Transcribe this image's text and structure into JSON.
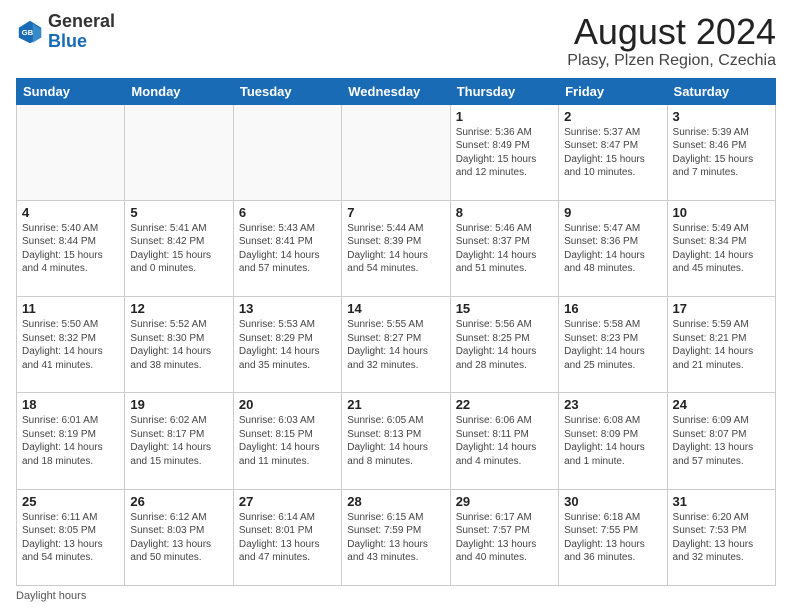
{
  "header": {
    "logo_general": "General",
    "logo_blue": "Blue",
    "month_title": "August 2024",
    "subtitle": "Plasy, Plzen Region, Czechia"
  },
  "calendar": {
    "days_of_week": [
      "Sunday",
      "Monday",
      "Tuesday",
      "Wednesday",
      "Thursday",
      "Friday",
      "Saturday"
    ],
    "weeks": [
      [
        {
          "day": "",
          "info": ""
        },
        {
          "day": "",
          "info": ""
        },
        {
          "day": "",
          "info": ""
        },
        {
          "day": "",
          "info": ""
        },
        {
          "day": "1",
          "info": "Sunrise: 5:36 AM\nSunset: 8:49 PM\nDaylight: 15 hours\nand 12 minutes."
        },
        {
          "day": "2",
          "info": "Sunrise: 5:37 AM\nSunset: 8:47 PM\nDaylight: 15 hours\nand 10 minutes."
        },
        {
          "day": "3",
          "info": "Sunrise: 5:39 AM\nSunset: 8:46 PM\nDaylight: 15 hours\nand 7 minutes."
        }
      ],
      [
        {
          "day": "4",
          "info": "Sunrise: 5:40 AM\nSunset: 8:44 PM\nDaylight: 15 hours\nand 4 minutes."
        },
        {
          "day": "5",
          "info": "Sunrise: 5:41 AM\nSunset: 8:42 PM\nDaylight: 15 hours\nand 0 minutes."
        },
        {
          "day": "6",
          "info": "Sunrise: 5:43 AM\nSunset: 8:41 PM\nDaylight: 14 hours\nand 57 minutes."
        },
        {
          "day": "7",
          "info": "Sunrise: 5:44 AM\nSunset: 8:39 PM\nDaylight: 14 hours\nand 54 minutes."
        },
        {
          "day": "8",
          "info": "Sunrise: 5:46 AM\nSunset: 8:37 PM\nDaylight: 14 hours\nand 51 minutes."
        },
        {
          "day": "9",
          "info": "Sunrise: 5:47 AM\nSunset: 8:36 PM\nDaylight: 14 hours\nand 48 minutes."
        },
        {
          "day": "10",
          "info": "Sunrise: 5:49 AM\nSunset: 8:34 PM\nDaylight: 14 hours\nand 45 minutes."
        }
      ],
      [
        {
          "day": "11",
          "info": "Sunrise: 5:50 AM\nSunset: 8:32 PM\nDaylight: 14 hours\nand 41 minutes."
        },
        {
          "day": "12",
          "info": "Sunrise: 5:52 AM\nSunset: 8:30 PM\nDaylight: 14 hours\nand 38 minutes."
        },
        {
          "day": "13",
          "info": "Sunrise: 5:53 AM\nSunset: 8:29 PM\nDaylight: 14 hours\nand 35 minutes."
        },
        {
          "day": "14",
          "info": "Sunrise: 5:55 AM\nSunset: 8:27 PM\nDaylight: 14 hours\nand 32 minutes."
        },
        {
          "day": "15",
          "info": "Sunrise: 5:56 AM\nSunset: 8:25 PM\nDaylight: 14 hours\nand 28 minutes."
        },
        {
          "day": "16",
          "info": "Sunrise: 5:58 AM\nSunset: 8:23 PM\nDaylight: 14 hours\nand 25 minutes."
        },
        {
          "day": "17",
          "info": "Sunrise: 5:59 AM\nSunset: 8:21 PM\nDaylight: 14 hours\nand 21 minutes."
        }
      ],
      [
        {
          "day": "18",
          "info": "Sunrise: 6:01 AM\nSunset: 8:19 PM\nDaylight: 14 hours\nand 18 minutes."
        },
        {
          "day": "19",
          "info": "Sunrise: 6:02 AM\nSunset: 8:17 PM\nDaylight: 14 hours\nand 15 minutes."
        },
        {
          "day": "20",
          "info": "Sunrise: 6:03 AM\nSunset: 8:15 PM\nDaylight: 14 hours\nand 11 minutes."
        },
        {
          "day": "21",
          "info": "Sunrise: 6:05 AM\nSunset: 8:13 PM\nDaylight: 14 hours\nand 8 minutes."
        },
        {
          "day": "22",
          "info": "Sunrise: 6:06 AM\nSunset: 8:11 PM\nDaylight: 14 hours\nand 4 minutes."
        },
        {
          "day": "23",
          "info": "Sunrise: 6:08 AM\nSunset: 8:09 PM\nDaylight: 14 hours\nand 1 minute."
        },
        {
          "day": "24",
          "info": "Sunrise: 6:09 AM\nSunset: 8:07 PM\nDaylight: 13 hours\nand 57 minutes."
        }
      ],
      [
        {
          "day": "25",
          "info": "Sunrise: 6:11 AM\nSunset: 8:05 PM\nDaylight: 13 hours\nand 54 minutes."
        },
        {
          "day": "26",
          "info": "Sunrise: 6:12 AM\nSunset: 8:03 PM\nDaylight: 13 hours\nand 50 minutes."
        },
        {
          "day": "27",
          "info": "Sunrise: 6:14 AM\nSunset: 8:01 PM\nDaylight: 13 hours\nand 47 minutes."
        },
        {
          "day": "28",
          "info": "Sunrise: 6:15 AM\nSunset: 7:59 PM\nDaylight: 13 hours\nand 43 minutes."
        },
        {
          "day": "29",
          "info": "Sunrise: 6:17 AM\nSunset: 7:57 PM\nDaylight: 13 hours\nand 40 minutes."
        },
        {
          "day": "30",
          "info": "Sunrise: 6:18 AM\nSunset: 7:55 PM\nDaylight: 13 hours\nand 36 minutes."
        },
        {
          "day": "31",
          "info": "Sunrise: 6:20 AM\nSunset: 7:53 PM\nDaylight: 13 hours\nand 32 minutes."
        }
      ]
    ]
  },
  "footer": {
    "note": "Daylight hours"
  }
}
